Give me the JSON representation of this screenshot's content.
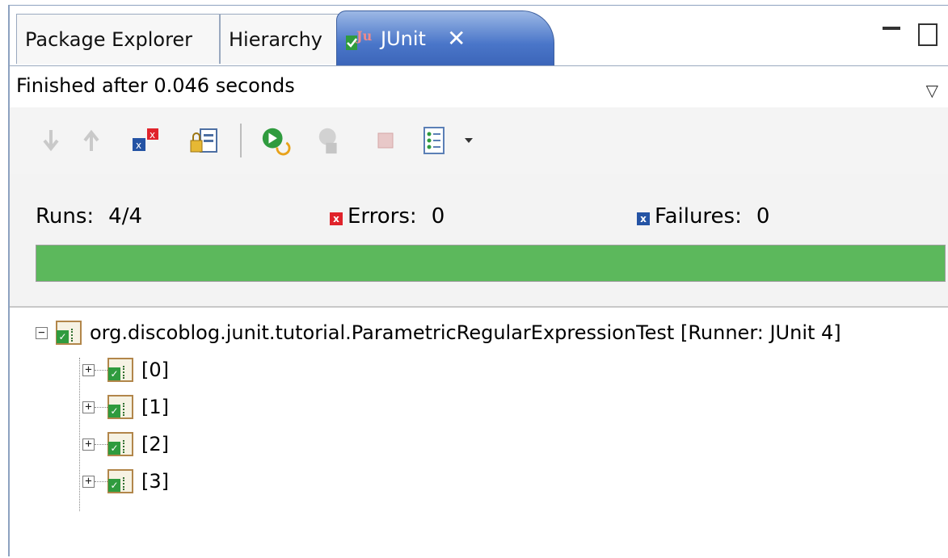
{
  "page_caption": "",
  "tabs": [
    {
      "label": "Package Explorer",
      "active": false
    },
    {
      "label": "Hierarchy",
      "active": false
    },
    {
      "label": "JUnit",
      "active": true
    }
  ],
  "tab_close_symbol": "✕",
  "window_controls": {
    "minimize_icon": "minimize-icon",
    "maximize_icon": "maximize-icon"
  },
  "status": {
    "text": "Finished after 0.046 seconds"
  },
  "toolbar": {
    "items": [
      {
        "icon": "next-failure-icon",
        "enabled": false
      },
      {
        "icon": "previous-failure-icon",
        "enabled": false
      },
      {
        "icon": "show-failures-only-icon",
        "enabled": true
      },
      {
        "icon": "scroll-lock-icon",
        "enabled": true
      },
      {
        "icon": "rerun-test-icon",
        "enabled": true
      },
      {
        "icon": "rerun-failed-first-icon",
        "enabled": false
      },
      {
        "icon": "stop-icon",
        "enabled": false
      },
      {
        "icon": "test-run-history-icon",
        "enabled": true
      },
      {
        "icon": "dropdown-arrow-icon",
        "enabled": true
      }
    ]
  },
  "counters": {
    "runs_label": "Runs:",
    "runs_value": "4/4",
    "errors_label": "Errors:",
    "errors_value": "0",
    "failures_label": "Failures:",
    "failures_value": "0",
    "error_badge": "x",
    "failure_badge": "x"
  },
  "progress": {
    "fraction": 1.0,
    "color": "#5cb85c"
  },
  "tree": {
    "root": {
      "label": "org.discoblog.junit.tutorial.ParametricRegularExpressionTest [Runner: JUnit 4]",
      "expanded": true
    },
    "children": [
      {
        "label": "[0]",
        "expanded": false
      },
      {
        "label": "[1]",
        "expanded": false
      },
      {
        "label": "[2]",
        "expanded": false
      },
      {
        "label": "[3]",
        "expanded": false
      }
    ]
  },
  "colors": {
    "active_tab": "#4a76c9",
    "error": "#e0232b",
    "failure": "#2453a4",
    "success": "#2f9b3e"
  }
}
